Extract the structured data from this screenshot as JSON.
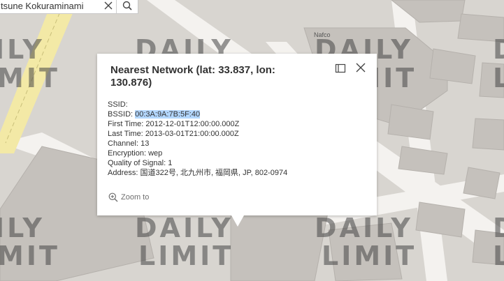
{
  "search": {
    "value": "tsune Kokuraminami",
    "clear_icon": "close-icon",
    "search_icon": "search-icon"
  },
  "map": {
    "place_label": "Nafco",
    "watermark_line1": "DAILY",
    "watermark_line2": "LIMIT",
    "watermark_fragments": [
      "ILY",
      "MIT"
    ],
    "colors": {
      "background": "#d8d5d0",
      "building": "#c5c1bc",
      "road": "#f4f2ef",
      "highway": "#f3e9a6"
    }
  },
  "popup": {
    "title": "Nearest Network (lat: 33.837, lon: 130.876)",
    "dock_icon": "dock-icon",
    "close_icon": "close-icon",
    "fields": {
      "ssid_label": "SSID:",
      "ssid_value": "",
      "bssid_label": "BSSID:",
      "bssid_value": "00:3A:9A:7B:5F:40",
      "first_time_label": "First Time:",
      "first_time_value": "2012-12-01T12:00:00.000Z",
      "last_time_label": "Last Time:",
      "last_time_value": "2013-03-01T21:00:00.000Z",
      "channel_label": "Channel:",
      "channel_value": "13",
      "encryption_label": "Encryption:",
      "encryption_value": "wep",
      "quality_label": "Quality of Signal:",
      "quality_value": "1",
      "address_label": "Address:",
      "address_value": "国道322号, 北九州市, 福岡県, JP, 802-0974"
    },
    "zoom_label": "Zoom to",
    "zoom_icon": "zoom-in-icon"
  }
}
